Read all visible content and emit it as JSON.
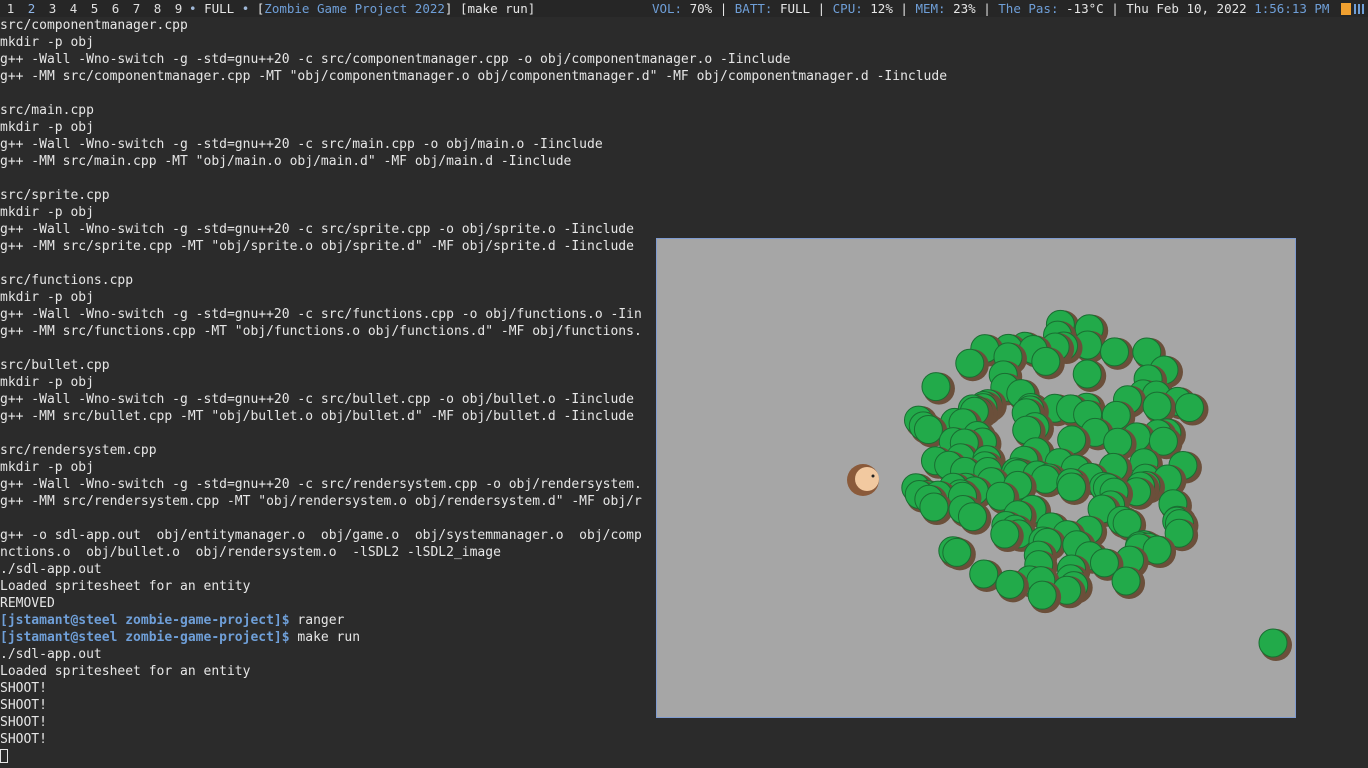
{
  "statusbar": {
    "workspaces": [
      "1",
      "2",
      "3",
      "4",
      "5",
      "6",
      "7",
      "8",
      "9"
    ],
    "active_workspace": "2",
    "mode": "FULL",
    "bullet": "•",
    "window_title": "Zombie Game Project 2022",
    "command": "[make run]",
    "vol_label": "VOL:",
    "vol_value": "70%",
    "batt_label": "BATT:",
    "batt_value": "FULL",
    "cpu_label": "CPU:",
    "cpu_value": "12%",
    "mem_label": "MEM:",
    "mem_value": "23%",
    "weather_label": "The Pas:",
    "weather_value": "-13°C",
    "date": "Thu Feb 10, 2022",
    "time": "1:56:13 PM",
    "sep": "|",
    "tray_icons": [
      "battery-icon",
      "signal-icon"
    ]
  },
  "terminal": {
    "prompt_user": "[jstamant@steel zombie-game-project]$",
    "lines": [
      "src/componentmanager.cpp",
      "mkdir -p obj",
      "g++ -Wall -Wno-switch -g -std=gnu++20 -c src/componentmanager.cpp -o obj/componentmanager.o -Iinclude",
      "g++ -MM src/componentmanager.cpp -MT \"obj/componentmanager.o obj/componentmanager.d\" -MF obj/componentmanager.d -Iinclude",
      "",
      "src/main.cpp",
      "mkdir -p obj",
      "g++ -Wall -Wno-switch -g -std=gnu++20 -c src/main.cpp -o obj/main.o -Iinclude",
      "g++ -MM src/main.cpp -MT \"obj/main.o obj/main.d\" -MF obj/main.d -Iinclude",
      "",
      "src/sprite.cpp",
      "mkdir -p obj",
      "g++ -Wall -Wno-switch -g -std=gnu++20 -c src/sprite.cpp -o obj/sprite.o -Iinclude",
      "g++ -MM src/sprite.cpp -MT \"obj/sprite.o obj/sprite.d\" -MF obj/sprite.d -Iinclude",
      "",
      "src/functions.cpp",
      "mkdir -p obj",
      "g++ -Wall -Wno-switch -g -std=gnu++20 -c src/functions.cpp -o obj/functions.o -Iin",
      "g++ -MM src/functions.cpp -MT \"obj/functions.o obj/functions.d\" -MF obj/functions.",
      "",
      "src/bullet.cpp",
      "mkdir -p obj",
      "g++ -Wall -Wno-switch -g -std=gnu++20 -c src/bullet.cpp -o obj/bullet.o -Iinclude",
      "g++ -MM src/bullet.cpp -MT \"obj/bullet.o obj/bullet.d\" -MF obj/bullet.d -Iinclude",
      "",
      "src/rendersystem.cpp",
      "mkdir -p obj",
      "g++ -Wall -Wno-switch -g -std=gnu++20 -c src/rendersystem.cpp -o obj/rendersystem.",
      "g++ -MM src/rendersystem.cpp -MT \"obj/rendersystem.o obj/rendersystem.d\" -MF obj/r",
      "",
      "g++ -o sdl-app.out  obj/entitymanager.o  obj/game.o  obj/systemmanager.o  obj/comp                                                          o  obj/fu",
      "nctions.o  obj/bullet.o  obj/rendersystem.o  -lSDL2 -lSDL2_image",
      "./sdl-app.out",
      "Loaded spritesheet for an entity",
      "REMOVED"
    ],
    "cmd_ranger": "ranger",
    "cmd_make": "make run",
    "after": [
      "./sdl-app.out",
      "Loaded spritesheet for an entity",
      "SHOOT!",
      "SHOOT!",
      "SHOOT!",
      "SHOOT!"
    ]
  },
  "game": {
    "background": "#a6a6a6",
    "zombie_color": "#22aa4a",
    "zombie_rim": "#6b4f3a",
    "player_face": "#f2c9a0",
    "player_hair": "#8a5a3a"
  }
}
